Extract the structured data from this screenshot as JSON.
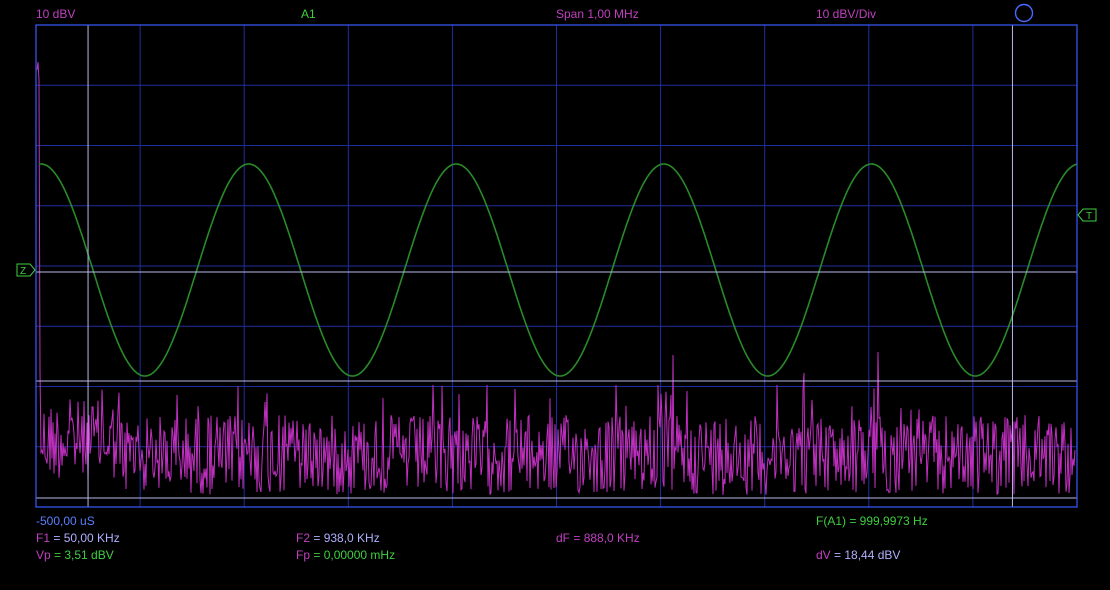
{
  "header": {
    "scale_left": "10 dBV",
    "channel": "A1",
    "span": "Span 1,00 MHz",
    "scale_div": "10 dBV/Div"
  },
  "markers": {
    "ground_marker": "Z",
    "trigger_marker": "T"
  },
  "time_offset": "-500,00 uS",
  "readouts": {
    "f1_label": "F1",
    "f1_value": " = 50,00 KHz",
    "f2_label": "F2",
    "f2_value": " = 938,0 KHz",
    "df_label": "dF",
    "df_value": " = 888,0 KHz",
    "fa1_label": "F(A1)",
    "fa1_value": " = 999,9973 Hz",
    "vp_label": "Vp",
    "vp_value": " = 3,51 dBV",
    "fp_label": "Fp",
    "fp_value": " = 0,00000 mHz",
    "dv_label": "dV",
    "dv_value": " = 18,44 dBV"
  },
  "colors": {
    "background": "#000000",
    "grid": "#1f2f9f",
    "border": "#3a5aff",
    "cursor": "#b8b8e8",
    "waveform": "#2a8a2a",
    "spectrum": "#c030c0",
    "header_magenta": "#c040c0",
    "header_green": "#3fcf3f"
  },
  "icons": {
    "status": "circle-outline-icon"
  },
  "chart_data": {
    "type": "line",
    "grid": true,
    "series": [
      {
        "kind": "time-domain sine",
        "cycles": 5,
        "frequency_hz": 999.9973
      },
      {
        "kind": "fft spectrum",
        "span_mhz": 1.0
      }
    ],
    "cursors": {
      "f1_khz": 50.0,
      "f2_khz": 938.0,
      "vp_dbv": 3.51,
      "dv_dbv": 18.44
    }
  }
}
